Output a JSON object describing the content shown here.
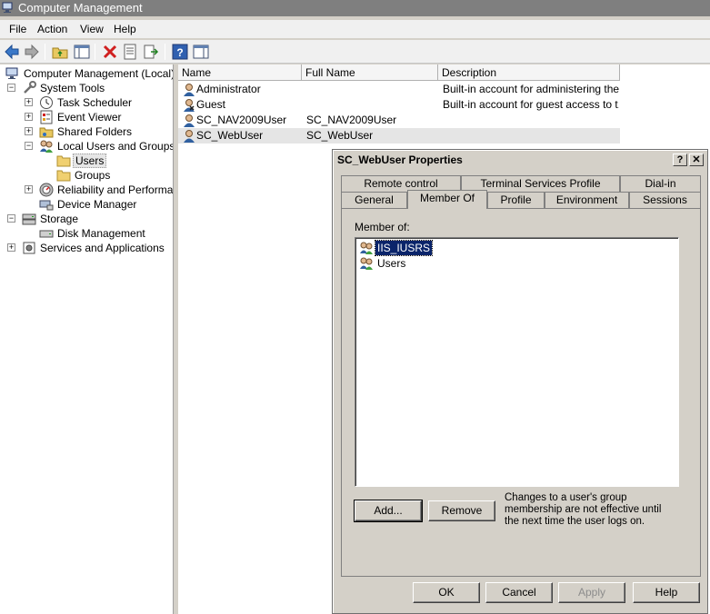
{
  "window": {
    "title": "Computer Management"
  },
  "menu": [
    "File",
    "Action",
    "View",
    "Help"
  ],
  "tree": [
    {
      "label": "Computer Management (Local)",
      "expander": ""
    },
    {
      "label": "System Tools",
      "expander": "−"
    },
    {
      "label": "Task Scheduler",
      "expander": "+"
    },
    {
      "label": "Event Viewer",
      "expander": "+"
    },
    {
      "label": "Shared Folders",
      "expander": "+"
    },
    {
      "label": "Local Users and Groups",
      "expander": "−"
    },
    {
      "label": "Users",
      "expander": ""
    },
    {
      "label": "Groups",
      "expander": ""
    },
    {
      "label": "Reliability and Performance",
      "expander": "+"
    },
    {
      "label": "Device Manager",
      "expander": ""
    },
    {
      "label": "Storage",
      "expander": "−"
    },
    {
      "label": "Disk Management",
      "expander": ""
    },
    {
      "label": "Services and Applications",
      "expander": "+"
    }
  ],
  "list": {
    "columns": [
      "Name",
      "Full Name",
      "Description"
    ],
    "rows": [
      {
        "name": "Administrator",
        "full_name": "",
        "description": "Built-in account for administering the..."
      },
      {
        "name": "Guest",
        "full_name": "",
        "description": "Built-in account for guest access to t..."
      },
      {
        "name": "SC_NAV2009User",
        "full_name": "SC_NAV2009User",
        "description": ""
      },
      {
        "name": "SC_WebUser",
        "full_name": "SC_WebUser",
        "description": ""
      }
    ]
  },
  "dialog": {
    "title": "SC_WebUser Properties",
    "help_glyph": "?",
    "close_glyph": "✕",
    "tabs_back": [
      "Remote control",
      "Terminal Services Profile",
      "Dial-in"
    ],
    "tabs_front": [
      "General",
      "Member Of",
      "Profile",
      "Environment",
      "Sessions"
    ],
    "active_tab": "Member Of",
    "member_of_label": "Member of:",
    "members": [
      "IIS_IUSRS",
      "Users"
    ],
    "add_button": "Add...",
    "remove_button": "Remove",
    "note": "Changes to a user's group membership are not effective until the next time the user logs on.",
    "ok": "OK",
    "cancel": "Cancel",
    "apply": "Apply",
    "help": "Help"
  }
}
